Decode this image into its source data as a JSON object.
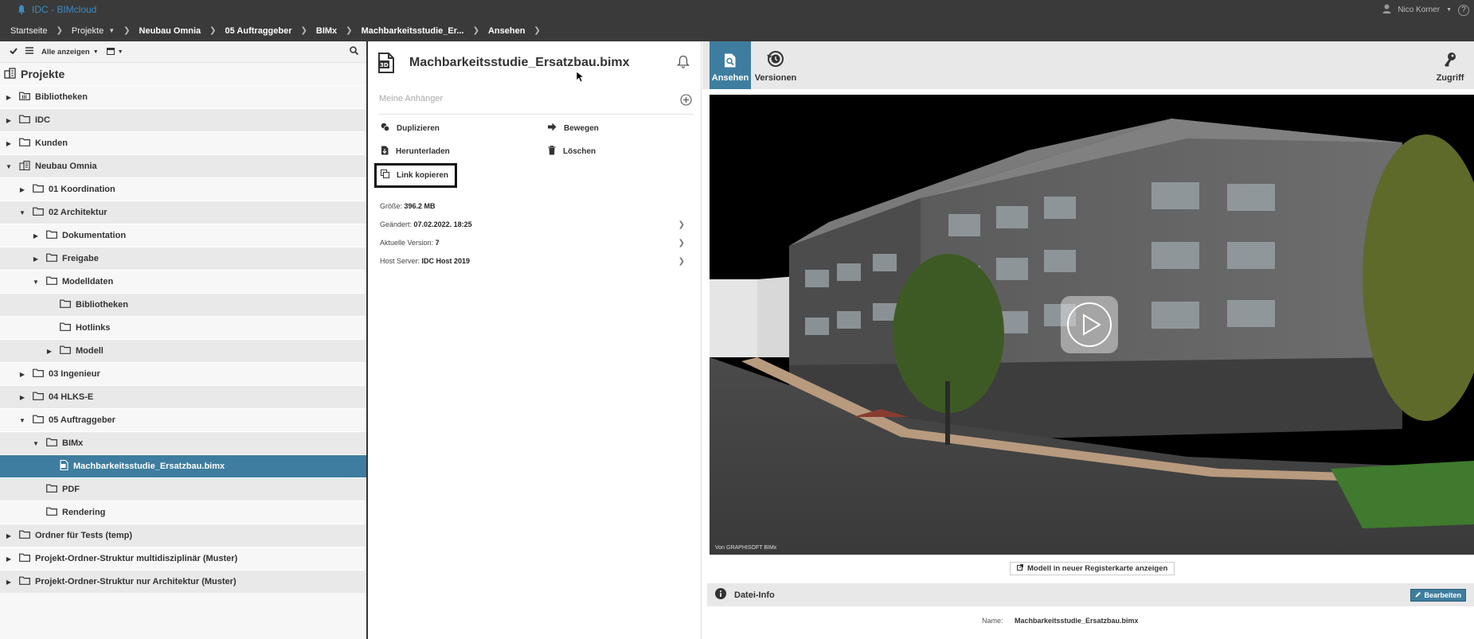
{
  "app": {
    "title": "IDC - BIMcloud",
    "user": "Nico Korner",
    "help": "?"
  },
  "breadcrumb": [
    {
      "label": "Startseite",
      "bold": false,
      "dropdown": false
    },
    {
      "label": "Projekte",
      "bold": false,
      "dropdown": true
    },
    {
      "label": "Neubau Omnia",
      "bold": true,
      "dropdown": false
    },
    {
      "label": "05 Auftraggeber",
      "bold": true,
      "dropdown": false
    },
    {
      "label": "BIMx",
      "bold": true,
      "dropdown": false
    },
    {
      "label": "Machbarkeitsstudie_Er...",
      "bold": true,
      "dropdown": false
    },
    {
      "label": "Ansehen",
      "bold": true,
      "dropdown": false
    }
  ],
  "sidebar": {
    "filter_label": "Alle anzeigen",
    "header": "Projekte",
    "tree": [
      {
        "label": "Bibliotheken",
        "level": 0,
        "toggle": "collapsed",
        "icon": "library-icon"
      },
      {
        "label": "IDC",
        "level": 0,
        "toggle": "collapsed",
        "icon": "folder-icon"
      },
      {
        "label": "Kunden",
        "level": 0,
        "toggle": "collapsed",
        "icon": "folder-icon"
      },
      {
        "label": "Neubau Omnia",
        "level": 0,
        "toggle": "expanded",
        "icon": "building-icon"
      },
      {
        "label": "01 Koordination",
        "level": 1,
        "toggle": "collapsed",
        "icon": "folder-icon"
      },
      {
        "label": "02 Architektur",
        "level": 1,
        "toggle": "expanded",
        "icon": "folder-icon"
      },
      {
        "label": "Dokumentation",
        "level": 2,
        "toggle": "collapsed",
        "icon": "folder-icon"
      },
      {
        "label": "Freigabe",
        "level": 2,
        "toggle": "collapsed",
        "icon": "folder-icon"
      },
      {
        "label": "Modelldaten",
        "level": 2,
        "toggle": "expanded",
        "icon": "folder-icon"
      },
      {
        "label": "Bibliotheken",
        "level": 3,
        "toggle": "none",
        "icon": "folder-icon"
      },
      {
        "label": "Hotlinks",
        "level": 3,
        "toggle": "none",
        "icon": "folder-icon"
      },
      {
        "label": "Modell",
        "level": 3,
        "toggle": "collapsed",
        "icon": "folder-icon"
      },
      {
        "label": "03 Ingenieur",
        "level": 1,
        "toggle": "collapsed",
        "icon": "folder-icon"
      },
      {
        "label": "04 HLKS-E",
        "level": 1,
        "toggle": "collapsed",
        "icon": "folder-icon"
      },
      {
        "label": "05 Auftraggeber",
        "level": 1,
        "toggle": "expanded",
        "icon": "folder-icon"
      },
      {
        "label": "BIMx",
        "level": 2,
        "toggle": "expanded",
        "icon": "folder-icon"
      },
      {
        "label": "Machbarkeitsstudie_Ersatzbau.bimx",
        "level": 3,
        "toggle": "none",
        "icon": "bimx-file-icon",
        "selected": true
      },
      {
        "label": "PDF",
        "level": 2,
        "toggle": "none",
        "icon": "folder-icon"
      },
      {
        "label": "Rendering",
        "level": 2,
        "toggle": "none",
        "icon": "folder-icon"
      },
      {
        "label": "Ordner für Tests (temp)",
        "level": 0,
        "toggle": "collapsed",
        "icon": "folder-icon"
      },
      {
        "label": "Projekt-Ordner-Struktur multidisziplinär (Muster)",
        "level": 0,
        "toggle": "collapsed",
        "icon": "folder-icon"
      },
      {
        "label": "Projekt-Ordner-Struktur nur Architektur (Muster)",
        "level": 0,
        "toggle": "collapsed",
        "icon": "folder-icon"
      }
    ]
  },
  "details": {
    "file_title": "Machbarkeitsstudie_Ersatzbau.bimx",
    "attachments_placeholder": "Meine Anhänger",
    "actions": {
      "duplicate": "Duplizieren",
      "move": "Bewegen",
      "download": "Herunterladen",
      "delete": "Löschen",
      "copy_link": "Link kopieren"
    },
    "info": {
      "size_label": "Größe:",
      "size_value": "396.2 MB",
      "changed_label": "Geändert:",
      "changed_value": "07.02.2022. 18:25",
      "version_label": "Aktuelle Version:",
      "version_value": "7",
      "host_label": "Host Server:",
      "host_value": "IDC Host 2019"
    }
  },
  "viewer": {
    "tabs": {
      "view": "Ansehen",
      "versions": "Versionen",
      "access": "Zugriff"
    },
    "credit": "Von GRAPHISOFT BIMx",
    "open_new_tab": "Modell in neuer Registerkarte anzeigen",
    "file_info_title": "Datei-Info",
    "edit_label": "Bearbeiten",
    "name_label": "Name:",
    "name_value": "Machbarkeitsstudie_Ersatzbau.bimx"
  }
}
